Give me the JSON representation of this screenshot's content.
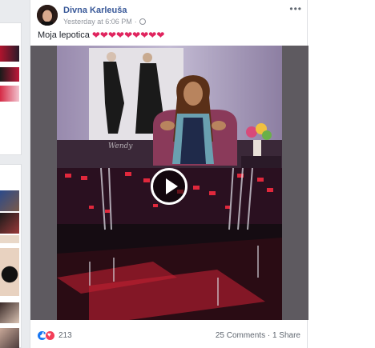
{
  "post": {
    "author": "Divna Karleuša",
    "timestamp": "Yesterday at 6:06 PM",
    "text": "Moja lepotica",
    "hearts": [
      "❤",
      "❤",
      "❤",
      "❤",
      "❤",
      "❤",
      "❤",
      "❤",
      "❤"
    ],
    "more_label": "•••",
    "reaction_count": "213",
    "comments": "25 Comments",
    "separator": " · ",
    "shares": "1 Share",
    "video_watermark": "Wendy",
    "privacy_icon": "globe-icon",
    "reactions": [
      "like-icon",
      "love-icon"
    ]
  },
  "colors": {
    "link": "#385898",
    "heart": "#e0245e",
    "like": "#1877f2",
    "love": "#f33e58"
  }
}
